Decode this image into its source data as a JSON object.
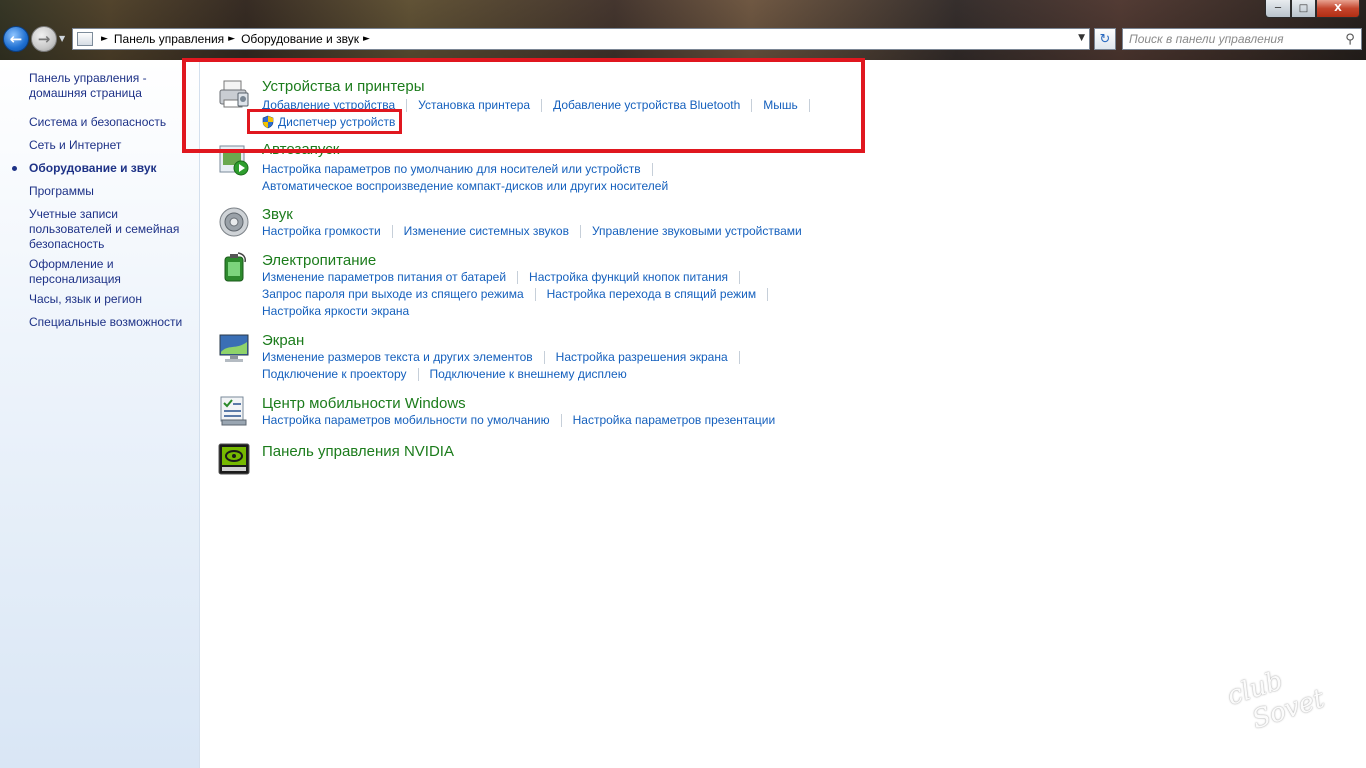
{
  "window": {
    "minimize_icon": "minimize-icon",
    "maximize_icon": "maximize-icon",
    "close_label": "X"
  },
  "navigation": {
    "back_icon": "arrow-left-icon",
    "forward_icon": "arrow-right-icon"
  },
  "address_bar": {
    "breadcrumbs": [
      "Панель управления",
      "Оборудование и звук"
    ]
  },
  "search": {
    "placeholder": "Поиск в панели управления"
  },
  "sidebar": {
    "items": [
      {
        "label": "Панель управления -\nдомашняя страница",
        "active": false
      },
      {
        "label": "Система и безопасность",
        "active": false
      },
      {
        "label": "Сеть и Интернет",
        "active": false
      },
      {
        "label": "Оборудование и звук",
        "active": true
      },
      {
        "label": "Программы",
        "active": false
      },
      {
        "label": "Учетные записи\nпользователей и семейная\nбезопасность",
        "active": false
      },
      {
        "label": "Оформление и\nперсонализация",
        "active": false
      },
      {
        "label": "Часы, язык и регион",
        "active": false
      },
      {
        "label": "Специальные возможности",
        "active": false
      }
    ]
  },
  "categories": [
    {
      "title": "Устройства и принтеры",
      "icon": "printer-icon",
      "rows": [
        [
          "Добавление устройства",
          "Установка принтера",
          "Добавление устройства Bluetooth",
          "Мышь"
        ],
        [
          "Диспетчер устройств"
        ]
      ]
    },
    {
      "title": "Автозапуск",
      "icon": "autoplay-icon",
      "rows": [
        [
          "Настройка параметров по умолчанию для носителей или устройств"
        ],
        [
          "Автоматическое воспроизведение компакт-дисков или других носителей"
        ]
      ]
    },
    {
      "title": "Звук",
      "icon": "speaker-icon",
      "rows": [
        [
          "Настройка громкости",
          "Изменение системных звуков",
          "Управление звуковыми устройствами"
        ]
      ]
    },
    {
      "title": "Электропитание",
      "icon": "battery-icon",
      "rows": [
        [
          "Изменение параметров питания от батарей",
          "Настройка функций кнопок питания"
        ],
        [
          "Запрос пароля при выходе из спящего режима",
          "Настройка перехода в спящий режим"
        ],
        [
          "Настройка яркости экрана"
        ]
      ]
    },
    {
      "title": "Экран",
      "icon": "monitor-icon",
      "rows": [
        [
          "Изменение размеров текста и других элементов",
          "Настройка разрешения экрана"
        ],
        [
          "Подключение к проектору",
          "Подключение к внешнему дисплею"
        ]
      ]
    },
    {
      "title": "Центр мобильности Windows",
      "icon": "mobility-center-icon",
      "rows": [
        [
          "Настройка параметров мобильности по умолчанию",
          "Настройка параметров презентации"
        ]
      ]
    },
    {
      "title": "Панель управления NVIDIA",
      "icon": "nvidia-icon",
      "rows": []
    }
  ],
  "watermark": {
    "text": "club Sovet"
  }
}
